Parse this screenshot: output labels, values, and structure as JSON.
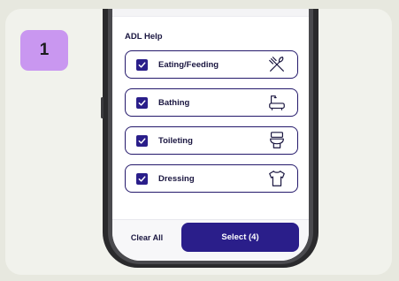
{
  "step": {
    "number": "1"
  },
  "section": {
    "title": "ADL Help"
  },
  "options": [
    {
      "label": "Eating/Feeding",
      "checked": true,
      "icon": "utensils-icon"
    },
    {
      "label": "Bathing",
      "checked": true,
      "icon": "bathtub-icon"
    },
    {
      "label": "Toileting",
      "checked": true,
      "icon": "toilet-icon"
    },
    {
      "label": "Dressing",
      "checked": true,
      "icon": "shirt-icon"
    }
  ],
  "footer": {
    "clear_label": "Clear All",
    "select_label": "Select (4)"
  },
  "colors": {
    "accent": "#2a1e8a",
    "step_badge": "#c997f0",
    "border": "#24196b",
    "background": "#e7e8df"
  }
}
